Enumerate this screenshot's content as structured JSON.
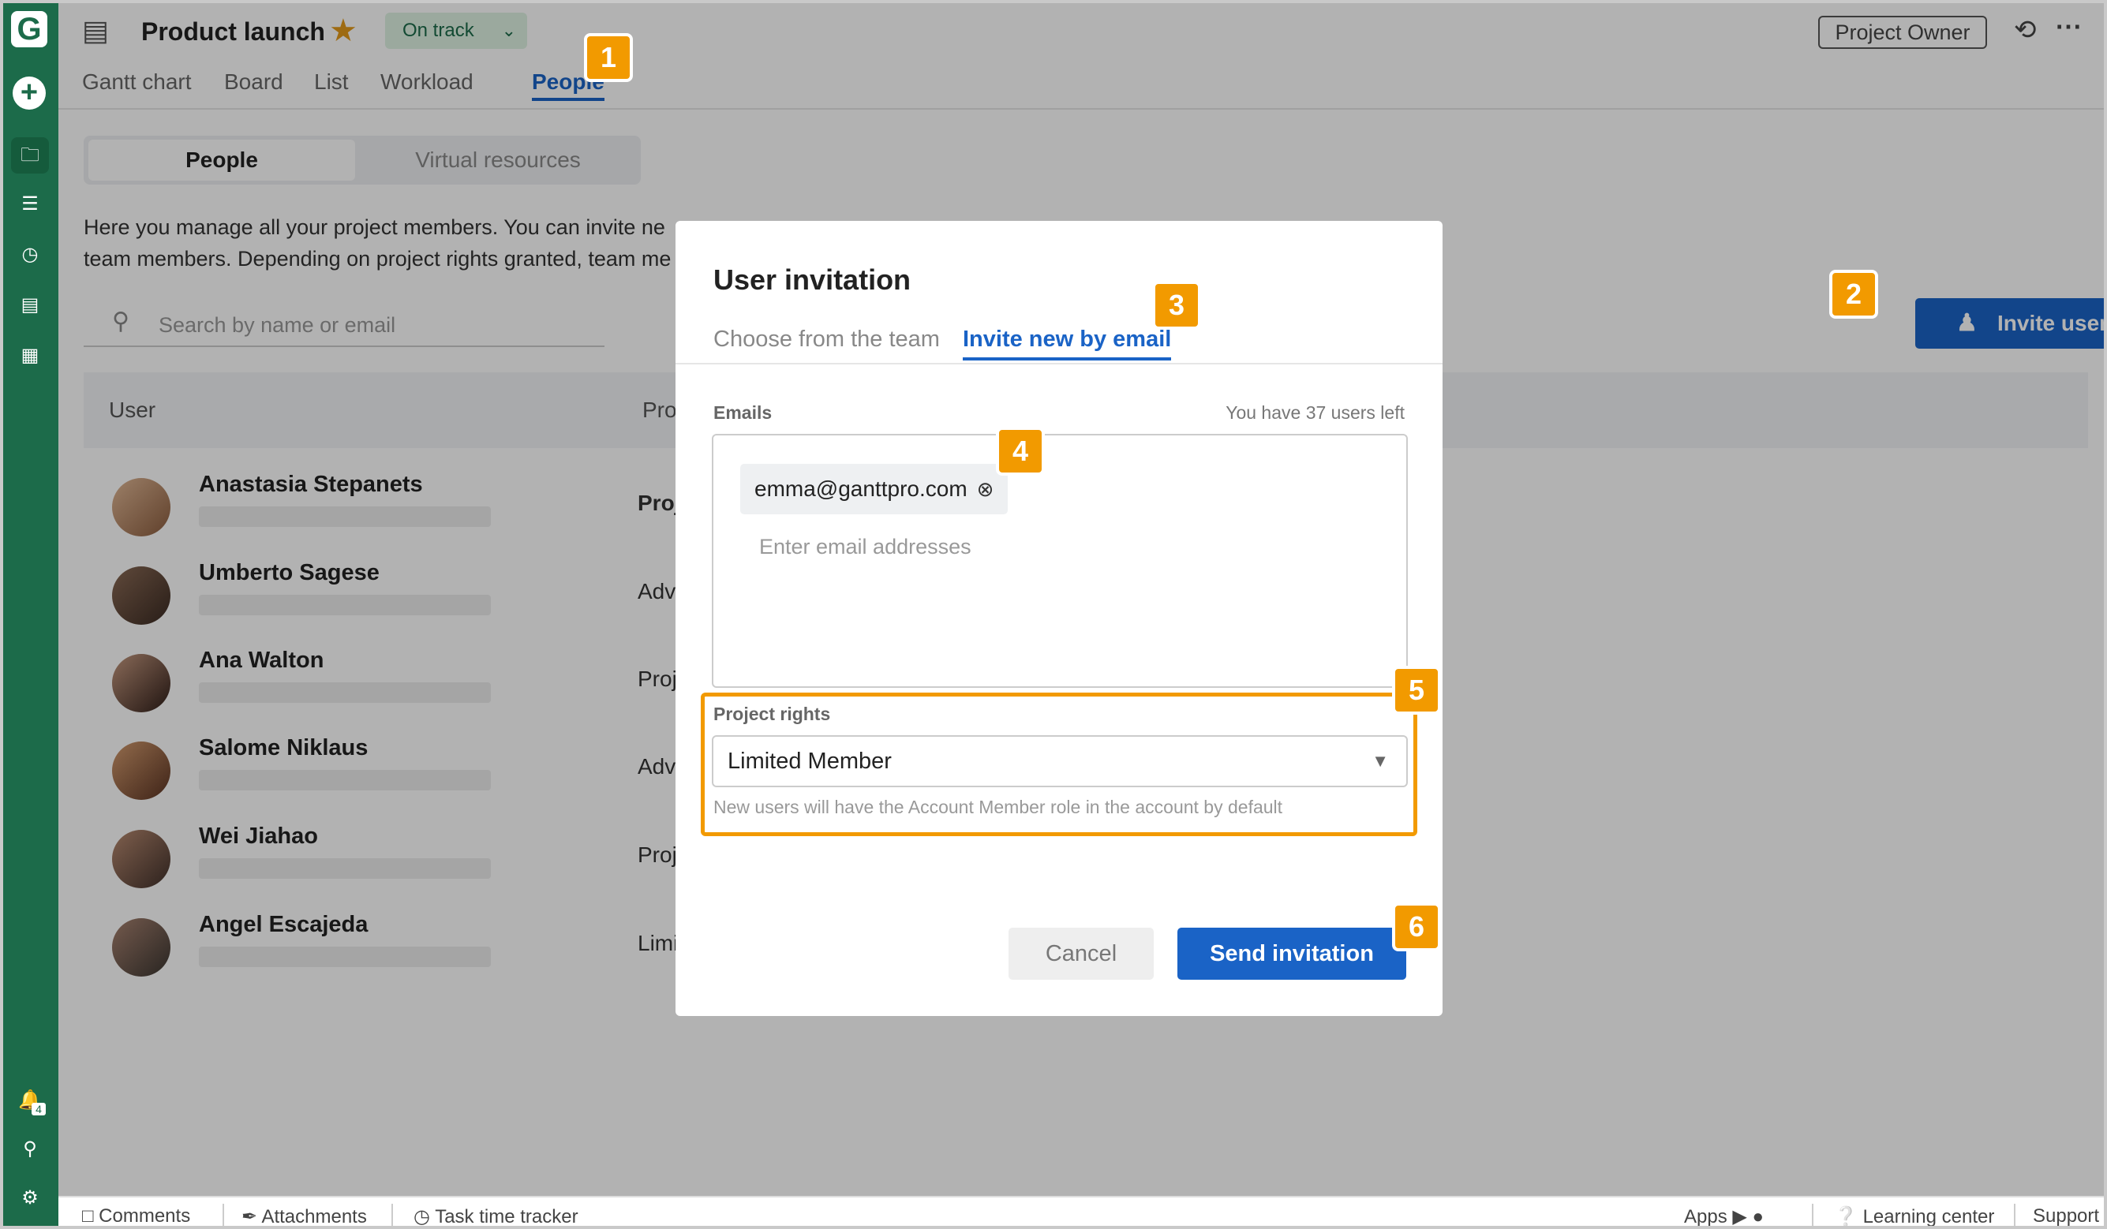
{
  "app": {
    "logo": "G"
  },
  "project": {
    "title": "Product launch",
    "status": "On track"
  },
  "tabs": [
    "Gantt chart",
    "Board",
    "List",
    "Workload",
    "People"
  ],
  "header": {
    "role_button": "Project Owner"
  },
  "segment": {
    "people": "People",
    "virtual": "Virtual resources"
  },
  "description": {
    "line1": "Here you manage all your project members. You can invite ne",
    "line2": "team members. Depending on project rights granted, team me"
  },
  "search": {
    "placeholder": "Search by name or email"
  },
  "table": {
    "col_user": "User",
    "col_rights": "Project ri",
    "rows": [
      {
        "name": "Anastasia Stepanets",
        "role": "Project C"
      },
      {
        "name": "Umberto Sagese",
        "role": "Advanced"
      },
      {
        "name": "Ana Walton",
        "role": "Project E"
      },
      {
        "name": "Salome Niklaus",
        "role": "Advanced"
      },
      {
        "name": "Wei Jiahao",
        "role": "Project E"
      },
      {
        "name": "Angel Escajeda",
        "role": "Limited N"
      }
    ]
  },
  "invite_button": "Invite users",
  "modal": {
    "title": "User invitation",
    "tab_team": "Choose from the team",
    "tab_email": "Invite new by email",
    "emails_label": "Emails",
    "users_left": "You have 37 users left",
    "chip": "emma@ganttpro.com",
    "email_placeholder": "Enter email addresses",
    "rights_label": "Project rights",
    "rights_value": "Limited Member",
    "hint": "New users will have the Account Member role in the account by default",
    "cancel": "Cancel",
    "send": "Send invitation"
  },
  "markers": [
    "1",
    "2",
    "3",
    "4",
    "5",
    "6"
  ],
  "footer": {
    "comments": "Comments",
    "attachments": "Attachments",
    "tracker": "Task time tracker",
    "apps": "Apps",
    "learning": "Learning center",
    "support": "Support"
  },
  "notifications_count": "4",
  "colors": {
    "brand_green": "#1c6b4a",
    "accent_blue": "#1a63c6",
    "marker_orange": "#f29a00"
  }
}
